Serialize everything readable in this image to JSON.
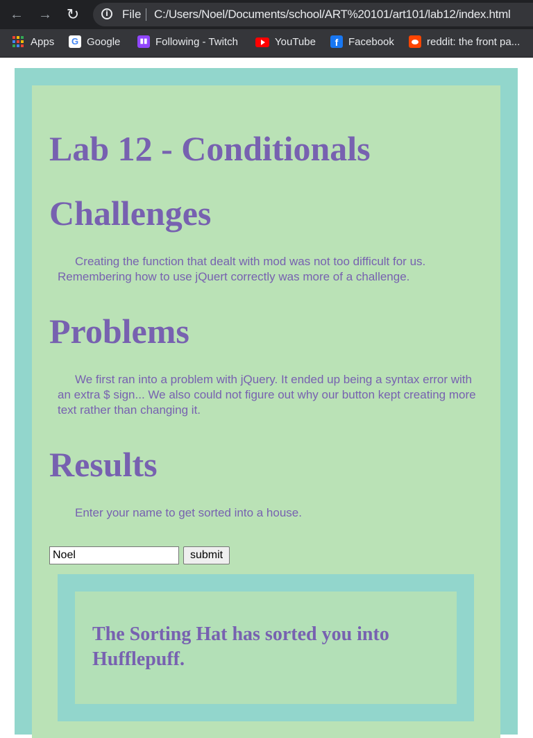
{
  "browser": {
    "nav": {
      "back": "←",
      "forward": "→",
      "reload": "↻"
    },
    "address_bar": {
      "info_icon": "i",
      "file_label": "File",
      "url": "C:/Users/Noel/Documents/school/ART%20101/art101/lab12/index.html"
    },
    "bookmarks": [
      {
        "label": "Apps",
        "icon": "apps-grid-icon"
      },
      {
        "label": "Google",
        "icon": "google-icon"
      },
      {
        "label": "Following - Twitch",
        "icon": "twitch-icon"
      },
      {
        "label": "YouTube",
        "icon": "youtube-icon"
      },
      {
        "label": "Facebook",
        "icon": "facebook-icon"
      },
      {
        "label": "reddit: the front pa...",
        "icon": "reddit-icon"
      }
    ]
  },
  "page": {
    "title": "Lab 12 - Conditionals",
    "challenges": {
      "heading": "Challenges",
      "text": "Creating the function that dealt with mod was not too difficult for us. Remembering how to use jQuert correctly was more of a challenge."
    },
    "problems": {
      "heading": "Problems",
      "text": "We first ran into a problem with jQuery. It ended up being a syntax error with an extra $ sign... We also could not figure out why our button kept creating more text rather than changing it."
    },
    "results": {
      "heading": "Results",
      "prompt": "Enter your name to get sorted into a house.",
      "input_value": "Noel",
      "submit_label": "submit",
      "output": "The Sorting Hat has sorted you into Hufflepuff."
    }
  },
  "colors": {
    "chrome_dark": "#202124",
    "chrome_bar": "#35363a",
    "outer_teal": "#92d6cc",
    "inner_green": "#bae2b6",
    "text_purple": "#7761b0"
  }
}
